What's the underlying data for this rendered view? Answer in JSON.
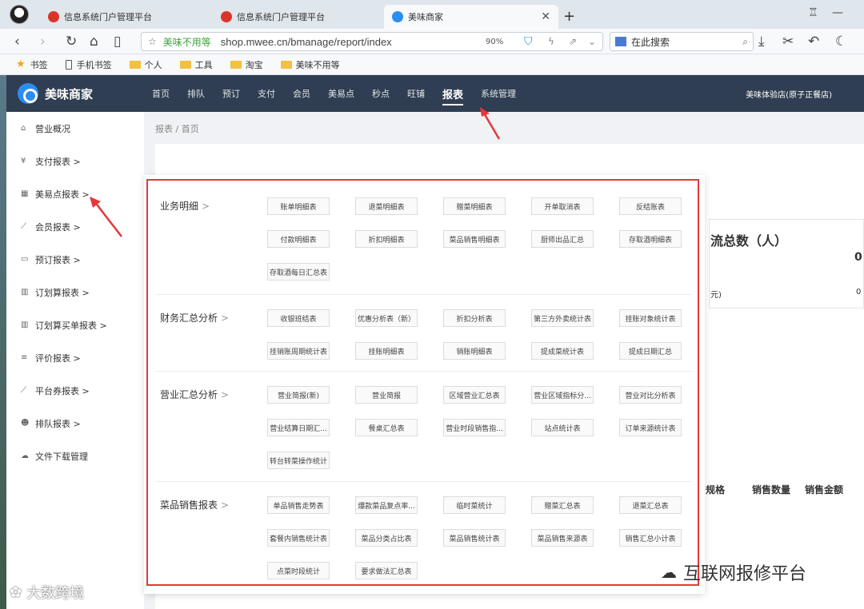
{
  "browser": {
    "tabs": [
      {
        "label": "信息系统门户管理平台",
        "active": false
      },
      {
        "label": "信息系统门户管理平台",
        "active": false
      },
      {
        "label": "美味商家",
        "active": true
      }
    ],
    "new_tab": "+",
    "address": {
      "site_label": "美味不用等",
      "url": "shop.mwee.cn/bmanage/report/index",
      "zoom": "90%"
    },
    "search_placeholder": "在此搜索",
    "bookmarks": [
      {
        "label": "书签",
        "icon": "star-icon"
      },
      {
        "label": "手机书签",
        "icon": "phone-icon"
      },
      {
        "label": "个人",
        "icon": "folder-icon"
      },
      {
        "label": "工具",
        "icon": "folder-icon"
      },
      {
        "label": "淘宝",
        "icon": "folder-icon"
      },
      {
        "label": "美味不用等",
        "icon": "folder-icon"
      }
    ]
  },
  "app": {
    "brand": "美味商家",
    "nav": [
      "首页",
      "排队",
      "预订",
      "支付",
      "会员",
      "美易点",
      "秒点",
      "旺铺",
      "报表",
      "系统管理"
    ],
    "active_nav": "报表",
    "store": "美味体验店(原子正餐店)",
    "sidebar": [
      {
        "icon": "home-icon",
        "glyph": "⌂",
        "label": "营业概况"
      },
      {
        "icon": "yen-icon",
        "glyph": "¥",
        "label": "支付报表 >"
      },
      {
        "icon": "grid-icon",
        "glyph": "▦",
        "label": "美易点报表 >"
      },
      {
        "icon": "line-chart-icon",
        "glyph": "⟋",
        "label": "会员报表 >"
      },
      {
        "icon": "doc-icon",
        "glyph": "▭",
        "label": "预订报表 >"
      },
      {
        "icon": "bar-chart-icon",
        "glyph": "▥",
        "label": "订划算报表 >"
      },
      {
        "icon": "bar-chart-icon",
        "glyph": "▥",
        "label": "订划算买单报表 >"
      },
      {
        "icon": "list-icon",
        "glyph": "≡",
        "label": "评价报表 >"
      },
      {
        "icon": "line-chart-icon",
        "glyph": "⟋",
        "label": "平台券报表 >"
      },
      {
        "icon": "users-icon",
        "glyph": "☻",
        "label": "排队报表 >"
      },
      {
        "icon": "cloud-download-icon",
        "glyph": "☁",
        "label": "文件下载管理"
      }
    ],
    "breadcrumb": "报表 / 首页",
    "background": {
      "title": "流总数（人）",
      "value1": "0",
      "unit_label": "元)",
      "value2": "0",
      "col1": "规格",
      "col2": "销售数量",
      "col3": "销售金额"
    }
  },
  "panel": {
    "sections": [
      {
        "title": "业务明细",
        "items": [
          "账单明细表",
          "退菜明细表",
          "赠菜明细表",
          "开单取消表",
          "反结账表",
          "付款明细表",
          "折扣明细表",
          "菜品销售明细表",
          "厨师出品汇总",
          "存取酒明细表",
          "存取酒每日汇总表"
        ]
      },
      {
        "title": "财务汇总分析",
        "items": [
          "收银班结表",
          "优惠分析表（新）",
          "折扣分析表",
          "第三方外卖统计表",
          "挂账对象统计表",
          "挂销账周期统计表",
          "挂账明细表",
          "销账明细表",
          "提成菜统计表",
          "提成日期汇总"
        ]
      },
      {
        "title": "营业汇总分析",
        "items": [
          "营业简报(新)",
          "营业简报",
          "区域营业汇总表",
          "营业区域指标分...",
          "营业对比分析表",
          "营业结算日期汇...",
          "餐桌汇总表",
          "营业时段销售指...",
          "站点统计表",
          "订单来源统计表",
          "转台转菜操作统计"
        ]
      },
      {
        "title": "菜品销售报表",
        "items": [
          "单品销售走势表",
          "爆款菜品复点率...",
          "临时菜统计",
          "赠菜汇总表",
          "退菜汇总表",
          "套餐内销售统计表",
          "菜品分类占比表",
          "菜品销售统计表",
          "菜品销售来源表",
          "销售汇总小计表",
          "点菜时段统计",
          "要求做法汇总表"
        ]
      }
    ]
  },
  "watermarks": {
    "left": "大数跨境",
    "right": "互联网报修平台"
  },
  "colors": {
    "nav_bg": "#2f3e52",
    "highlight_red": "#e5383b",
    "brand_blue": "#2d8cf0"
  }
}
